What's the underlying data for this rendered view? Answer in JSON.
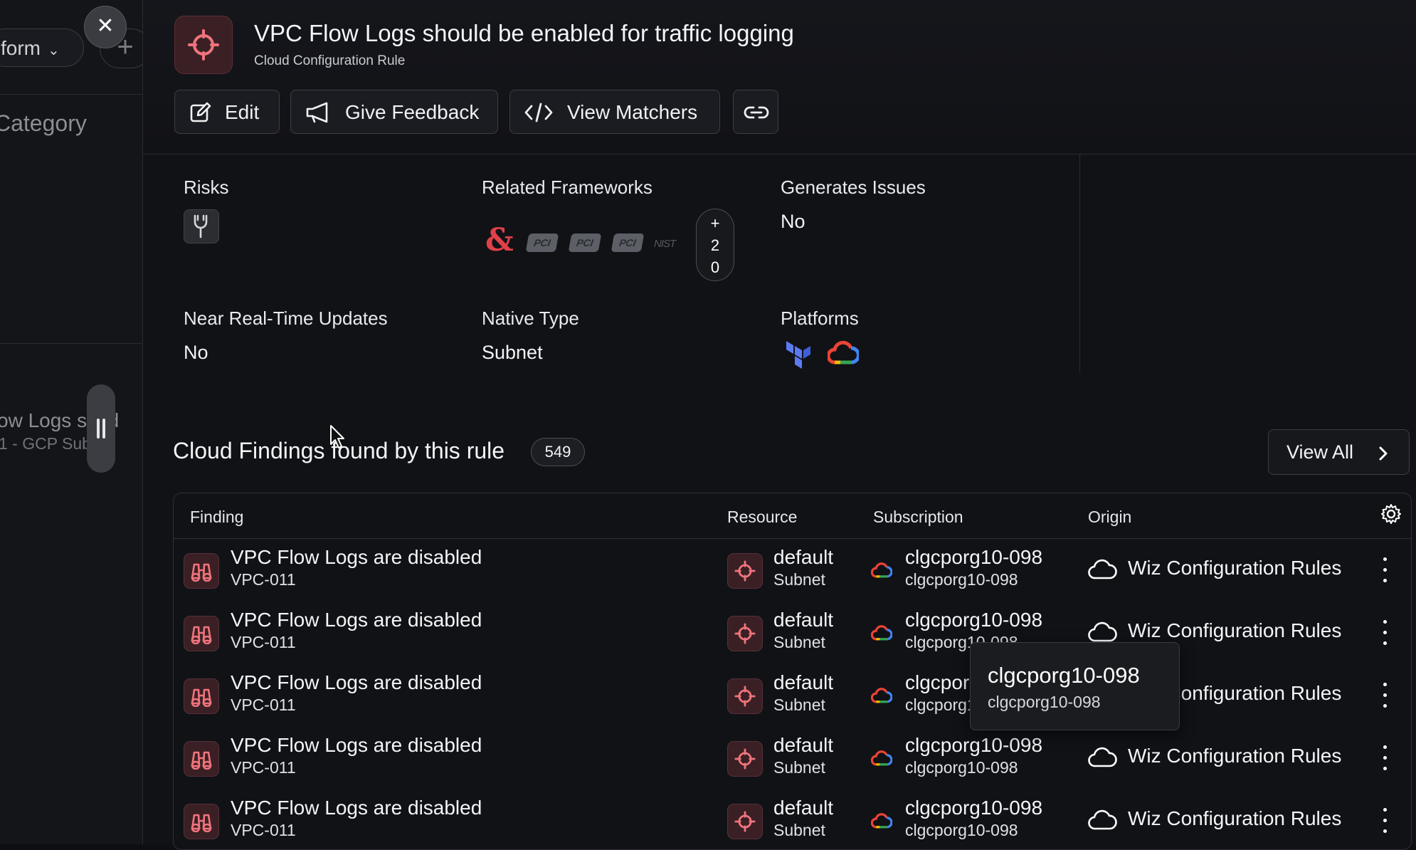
{
  "background": {
    "filter_chip_label": "form",
    "category_label": "Category",
    "row_title": "ow Logs s   uld",
    "row_subtitle": "1 - GCP Sub"
  },
  "drawer": {
    "title": "VPC Flow Logs should be enabled for traffic logging",
    "subtitle": "Cloud Configuration Rule",
    "actions": {
      "edit": "Edit",
      "feedback": "Give Feedback",
      "matchers": "View Matchers"
    }
  },
  "details": {
    "risks_label": "Risks",
    "frameworks_label": "Related Frameworks",
    "frameworks": [
      "&",
      "PCI",
      "PCI",
      "PCI",
      "NIST"
    ],
    "frameworks_more": [
      "+",
      "2",
      "0"
    ],
    "generates_issues_label": "Generates Issues",
    "generates_issues_value": "No",
    "near_realtime_label": "Near Real-Time Updates",
    "near_realtime_value": "No",
    "native_type_label": "Native Type",
    "native_type_value": "Subnet",
    "platforms_label": "Platforms",
    "platforms": [
      "terraform-icon",
      "gcp-icon"
    ]
  },
  "findings": {
    "title": "Cloud Findings found by this rule",
    "count": "549",
    "view_all": "View All",
    "columns": [
      "Finding",
      "Resource",
      "Subscription",
      "Origin"
    ],
    "rows": [
      {
        "finding": "VPC Flow Logs are disabled",
        "finding_id": "VPC-011",
        "resource": "default",
        "resource_type": "Subnet",
        "subscription": "clgcporg10-098",
        "subscription_id": "clgcporg10-098",
        "origin": "Wiz Configuration Rules"
      },
      {
        "finding": "VPC Flow Logs are disabled",
        "finding_id": "VPC-011",
        "resource": "default",
        "resource_type": "Subnet",
        "subscription": "clgcporg10-098",
        "subscription_id": "clgcporg10-098",
        "origin": "Wiz Configuration Rules"
      },
      {
        "finding": "VPC Flow Logs are disabled",
        "finding_id": "VPC-011",
        "resource": "default",
        "resource_type": "Subnet",
        "subscription": "clgcporg10-098",
        "subscription_id": "clgcporg10-098",
        "origin": "Wiz Configuration Rules"
      },
      {
        "finding": "VPC Flow Logs are disabled",
        "finding_id": "VPC-011",
        "resource": "default",
        "resource_type": "Subnet",
        "subscription": "clgcporg10-098",
        "subscription_id": "clgcporg10-098",
        "origin": "Wiz Configuration Rules"
      },
      {
        "finding": "VPC Flow Logs are disabled",
        "finding_id": "VPC-011",
        "resource": "default",
        "resource_type": "Subnet",
        "subscription": "clgcporg10-098",
        "subscription_id": "clgcporg10-098",
        "origin": "Wiz Configuration Rules"
      }
    ]
  },
  "tooltip": {
    "title": "clgcporg10-098",
    "subtitle": "clgcporg10-098"
  },
  "colors": {
    "accent_red": "#e0404a",
    "background": "#111216",
    "border": "#2e3035"
  }
}
